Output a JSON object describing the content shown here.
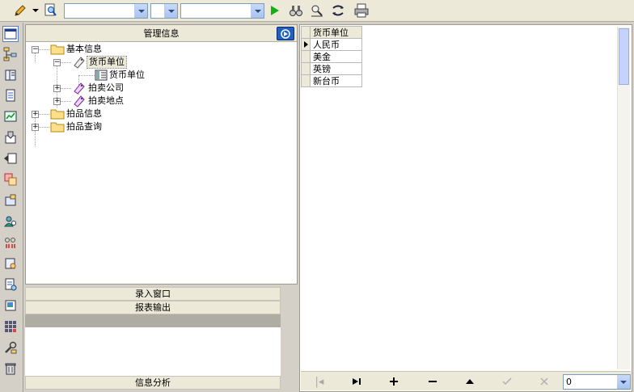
{
  "tree_panel": {
    "title": "管理信息",
    "nodes": [
      {
        "label": "基本信息"
      },
      {
        "label": "货币单位"
      },
      {
        "label": "货币单位"
      },
      {
        "label": "拍卖公司"
      },
      {
        "label": "拍卖地点"
      },
      {
        "label": "拍品信息"
      },
      {
        "label": "拍品查询"
      }
    ]
  },
  "bars": {
    "entry_window": "录入窗口",
    "report_output": "报表输出",
    "info_analysis": "信息分析"
  },
  "grid": {
    "column_header": "货币单位",
    "rows": [
      "人民币",
      "美金",
      "英镑",
      "新台币"
    ]
  },
  "navigator": {
    "combo_value": "0"
  }
}
